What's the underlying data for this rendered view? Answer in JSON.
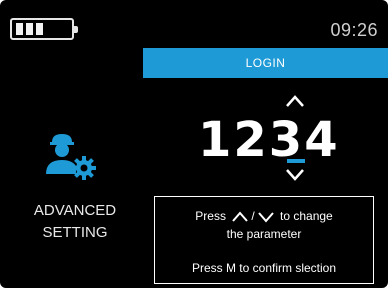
{
  "status": {
    "time": "09:26",
    "battery_level": 0.75
  },
  "sidebar": {
    "icon": "user-settings-icon",
    "label_line1": "ADVANCED",
    "label_line2": "SETTING"
  },
  "login": {
    "title": "LOGIN",
    "pin": "1234"
  },
  "help": {
    "press": "Press",
    "to_change": "to change",
    "the_parameter": "the parameter",
    "confirm": "Press M to confirm slection"
  },
  "colors": {
    "accent": "#1e9ad6",
    "background": "#000000",
    "text": "#ffffff"
  }
}
